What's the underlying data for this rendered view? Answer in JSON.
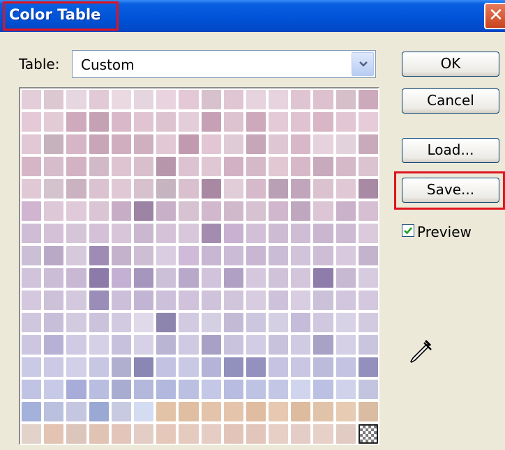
{
  "window": {
    "title": "Color Table",
    "close_glyph": "✕"
  },
  "table": {
    "label": "Table:",
    "selected": "Custom"
  },
  "buttons": {
    "ok": "OK",
    "cancel": "Cancel",
    "load": "Load...",
    "save": "Save..."
  },
  "preview": {
    "label": "Preview",
    "checked": true
  },
  "palette": {
    "rows": 16,
    "cols": 16,
    "colors": [
      [
        "#e3cdd8",
        "#dcc8d1",
        "#e6d6e0",
        "#e1cad6",
        "#ebd9e2",
        "#e5d5df",
        "#e9d3de",
        "#e3c8d5",
        "#d7c1cc",
        "#e0c5d2",
        "#e6d3dd",
        "#e6d3dd",
        "#dfc5d2",
        "#ddc1cf",
        "#d6bfc9",
        "#ccaabb"
      ],
      [
        "#e5c9d6",
        "#e3cbd6",
        "#cfa9bc",
        "#c5a1b4",
        "#d9b9c9",
        "#e1c4d1",
        "#dcc3cf",
        "#e3cdd8",
        "#c6a1b5",
        "#ddc2cf",
        "#cda9bb",
        "#e3cad6",
        "#dfc3d1",
        "#d8b6c6",
        "#e2c6d3",
        "#e5ccd8"
      ],
      [
        "#e1c8d4",
        "#c6b2bd",
        "#d6b5c6",
        "#c8a6b8",
        "#d0aec0",
        "#cfb0bf",
        "#e2c8d4",
        "#c19ab0",
        "#e2c6d4",
        "#dfcbd5",
        "#c6a6b8",
        "#dec6d3",
        "#d8b7c8",
        "#e6d2dd",
        "#e2d2dc",
        "#c9aabb"
      ],
      [
        "#d6b6c6",
        "#d7bccb",
        "#d2b2c3",
        "#d2b9c8",
        "#dec3d0",
        "#d8bfcb",
        "#b796ab",
        "#dbc3d1",
        "#e0c7d4",
        "#d2b1c5",
        "#d6b9c8",
        "#e1c8d3",
        "#d7b8c8",
        "#c7aabb",
        "#d5b9c8",
        "#dcc3d0"
      ],
      [
        "#e1c8d5",
        "#d4c2cd",
        "#cbb2c1",
        "#dac2d0",
        "#e1c8d5",
        "#d7c1cd",
        "#c6b4c0",
        "#d8c0cf",
        "#a988a3",
        "#e0cdd8",
        "#d6b9ca",
        "#b9a0b4",
        "#c1a5bb",
        "#dac3cf",
        "#e1c8d5",
        "#a88aa5"
      ],
      [
        "#d0b4d0",
        "#dcc8d6",
        "#e0cad9",
        "#dac5d4",
        "#c8adc6",
        "#9d84a5",
        "#c8b0c8",
        "#d6c2d1",
        "#d2b8cd",
        "#d0b9cb",
        "#d7c2d1",
        "#d1b7cd",
        "#bfa8bf",
        "#dcc6d6",
        "#cbb2cb",
        "#d7bfd3"
      ],
      [
        "#cfbcd5",
        "#d4c1d8",
        "#d6c5d9",
        "#d4c0d7",
        "#d8c5da",
        "#cbb8d0",
        "#d5c2d8",
        "#d8c7da",
        "#a38cb0",
        "#c9b1d1",
        "#d2c0d8",
        "#cdbbd3",
        "#cebdd5",
        "#cbb6d0",
        "#ccbbd3",
        "#dbc9dc"
      ],
      [
        "#cbbfd5",
        "#baa9c6",
        "#d6c9db",
        "#9f8cb5",
        "#c4b2cd",
        "#cdbed4",
        "#dbcde1",
        "#cfbad8",
        "#c7b7d3",
        "#cbbbd6",
        "#c8b6d2",
        "#cbbcd5",
        "#d1c3da",
        "#cdbed5",
        "#d9c9de",
        "#c4b3cd"
      ],
      [
        "#d0c3da",
        "#ccbdd7",
        "#c9b8d4",
        "#8c7ba9",
        "#c3b0d2",
        "#a596bd",
        "#ccbfd8",
        "#b8a9ca",
        "#d1c3db",
        "#b0a0c4",
        "#d5c8de",
        "#cfc2d9",
        "#d2c5dc",
        "#8e7daa",
        "#c8b9d3",
        "#d7cbe0"
      ],
      [
        "#d3c8dd",
        "#cdc0d9",
        "#d4c8de",
        "#9a8db8",
        "#ccbfd9",
        "#c2b5d4",
        "#ccc0db",
        "#cfc2da",
        "#cfc3dc",
        "#d1c5dc",
        "#d7cce0",
        "#cdc2da",
        "#d8cde1",
        "#cbc1d9",
        "#d1c6dd",
        "#d3c8dd"
      ],
      [
        "#cfc7de",
        "#c7bfda",
        "#d2cbe0",
        "#cbc2dc",
        "#d1cae1",
        "#e0d9ea",
        "#8d85ae",
        "#d1cae1",
        "#d5cfe4",
        "#c3bbd6",
        "#cdc6df",
        "#d5cfe3",
        "#c4bcd8",
        "#cfc8df",
        "#d8d2e6",
        "#d2cbe0"
      ],
      [
        "#ccc6e0",
        "#b8b1d6",
        "#d0cae4",
        "#d5d0e6",
        "#c7c1de",
        "#d6d1e6",
        "#bbb5d4",
        "#cfcae2",
        "#a8a1c5",
        "#c9c3de",
        "#d2cde4",
        "#c8c2dd",
        "#d0cbe3",
        "#a7a2c6",
        "#d5d0e6",
        "#cac5df"
      ],
      [
        "#cac9e6",
        "#cbc9e5",
        "#d2d0e8",
        "#c7c6e3",
        "#b1afcf",
        "#8a87b5",
        "#c3c2e2",
        "#cac9e5",
        "#b5b4d8",
        "#9290bd",
        "#9491bf",
        "#c5c3e1",
        "#c8c6e3",
        "#bdbbdb",
        "#c4c3e1",
        "#9390bd"
      ],
      [
        "#c0c3e3",
        "#c7cae6",
        "#a7add8",
        "#b9bde0",
        "#a9acd1",
        "#b4b8dd",
        "#b3b8de",
        "#bbbfe1",
        "#c4c7e5",
        "#b8bce0",
        "#bfc3e3",
        "#c3c6e4",
        "#d0d4ec",
        "#bcc0e2",
        "#cfd2ea",
        "#c3c4df"
      ],
      [
        "#a4b1db",
        "#bac1df",
        "#c5c6e0",
        "#9aa8d4",
        "#c7cae1",
        "#d4dcf2",
        "#e3c3a7",
        "#dfbea2",
        "#e3c4aa",
        "#e4c5ab",
        "#e0bda1",
        "#e6c9b0",
        "#ddbb9f",
        "#e1c3a9",
        "#e7cbb3",
        "#dabca3"
      ],
      [
        "#e3d2c9",
        "#e3c3b2",
        "#dcc5ba",
        "#e1c3b3",
        "#e3c6b9",
        "#e4cdc4",
        "#e5c8ba",
        "#e4cabf",
        "#e6cdc4",
        "#e2c4b8",
        "#e3c6bb",
        "#e7cfc6",
        "#e4cdc6",
        "#e6d0c8",
        "#e1cbc3",
        "checker"
      ]
    ]
  }
}
